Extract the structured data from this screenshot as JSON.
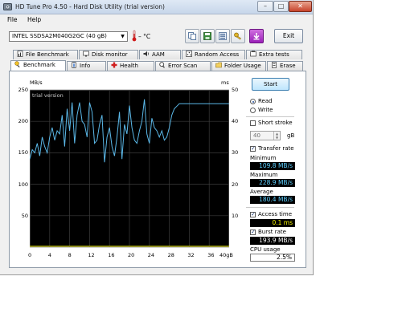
{
  "window": {
    "title": "HD Tune Pro 4.50 - Hard Disk Utility (trial version)",
    "controls": {
      "minimize": "–",
      "maximize": "□",
      "close": "✕"
    }
  },
  "menu": {
    "file": "File",
    "help": "Help"
  },
  "toolbar": {
    "drive": "INTEL SSDSA2M040G2GC (40 gB)",
    "temperature": "– °C",
    "exit_label": "Exit",
    "icons": [
      "copy-icon",
      "save-icon",
      "options-icon",
      "key-icon",
      "download-icon"
    ]
  },
  "tabs_top": [
    {
      "label": "File Benchmark",
      "icon": "file-benchmark-icon"
    },
    {
      "label": "Disk monitor",
      "icon": "disk-monitor-icon"
    },
    {
      "label": "AAM",
      "icon": "speaker-icon"
    },
    {
      "label": "Random Access",
      "icon": "random-access-icon"
    },
    {
      "label": "Extra tests",
      "icon": "extra-tests-icon"
    }
  ],
  "tabs_bottom": [
    {
      "label": "Benchmark",
      "icon": "benchmark-icon",
      "active": true
    },
    {
      "label": "Info",
      "icon": "info-icon"
    },
    {
      "label": "Health",
      "icon": "health-icon"
    },
    {
      "label": "Error Scan",
      "icon": "error-scan-icon"
    },
    {
      "label": "Folder Usage",
      "icon": "folder-icon"
    },
    {
      "label": "Erase",
      "icon": "erase-icon"
    }
  ],
  "chart_labels": {
    "left_unit": "MB/s",
    "right_unit": "ms",
    "watermark": "trial version"
  },
  "chart_data": {
    "type": "line",
    "x_ticks": [
      "0",
      "4",
      "8",
      "12",
      "16",
      "20",
      "24",
      "28",
      "32",
      "36",
      "40gB"
    ],
    "y_ticks_left": [
      "250",
      "200",
      "150",
      "100",
      "50"
    ],
    "y_ticks_right": [
      "50",
      "40",
      "30",
      "20",
      "10"
    ],
    "xlim": [
      0,
      40
    ],
    "ylim_left": [
      0,
      250
    ],
    "ylim_right": [
      0,
      50
    ],
    "grid": true,
    "series": [
      {
        "color": "#5bb8e8",
        "x": [
          0,
          0.5,
          1,
          1.5,
          2,
          2.5,
          3,
          3.5,
          4,
          4.5,
          5,
          5.5,
          6,
          6.5,
          7,
          7.5,
          8,
          8.5,
          9,
          9.5,
          10,
          10.5,
          11,
          11.5,
          12,
          12.5,
          13,
          13.5,
          14,
          14.5,
          15,
          15.5,
          16,
          16.5,
          17,
          17.5,
          18,
          18.5,
          19,
          19.5,
          20,
          20.5,
          21,
          21.5,
          22,
          22.5,
          23,
          23.5,
          24,
          24.5,
          25,
          25.5,
          26,
          26.5,
          27,
          27.5,
          28,
          28.5,
          29,
          30,
          34,
          38,
          40
        ],
        "y": [
          140,
          155,
          150,
          165,
          145,
          175,
          160,
          150,
          175,
          190,
          170,
          185,
          180,
          210,
          160,
          220,
          185,
          230,
          165,
          210,
          230,
          200,
          195,
          175,
          230,
          215,
          165,
          170,
          195,
          210,
          135,
          175,
          190,
          160,
          145,
          175,
          215,
          140,
          195,
          180,
          225,
          190,
          170,
          165,
          185,
          200,
          235,
          180,
          165,
          205,
          190,
          185,
          175,
          185,
          170,
          175,
          190,
          210,
          220,
          228,
          228,
          228,
          228
        ]
      }
    ]
  },
  "controls": {
    "start_label": "Start",
    "read_label": "Read",
    "write_label": "Write",
    "short_stroke_label": "Short stroke",
    "short_stroke_value": "40",
    "short_stroke_unit": "gB",
    "transfer_rate_label": "Transfer rate",
    "minimum_label": "Minimum",
    "minimum_value": "109.8 MB/s",
    "maximum_label": "Maximum",
    "maximum_value": "228.9 MB/s",
    "average_label": "Average",
    "average_value": "180.4 MB/s",
    "access_time_label": "Access time",
    "access_time_value": "0.1 ms",
    "burst_rate_label": "Burst rate",
    "burst_rate_value": "193.9 MB/s",
    "cpu_usage_label": "CPU usage",
    "cpu_usage_value": "2.5%"
  }
}
